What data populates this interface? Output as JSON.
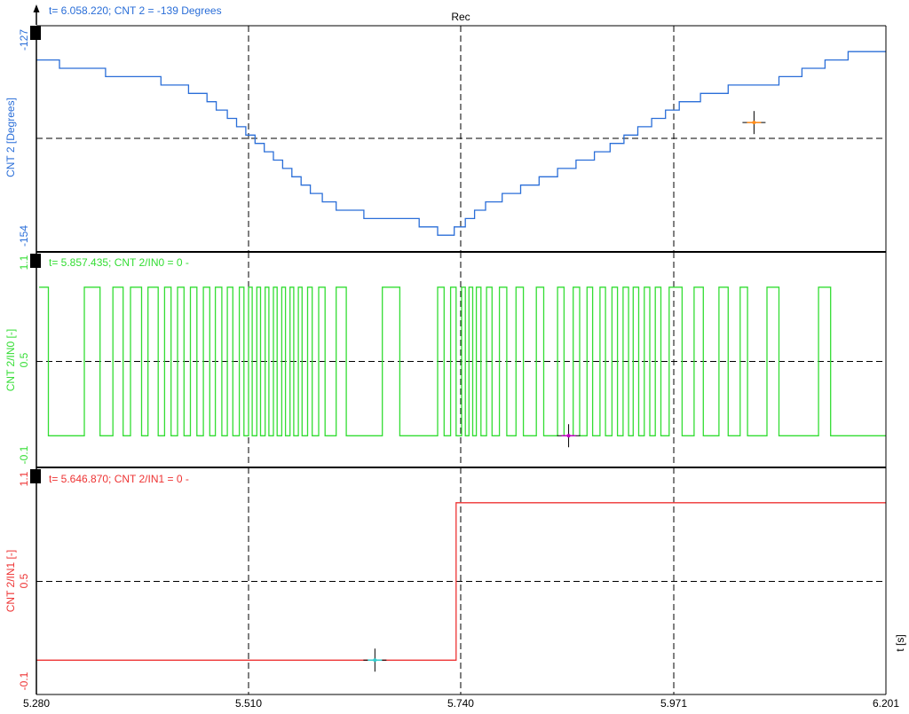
{
  "chart_data": {
    "type": "line",
    "title": "Rec",
    "xlabel": "t [s]",
    "xlim": [
      5.28,
      6.201
    ],
    "x_ticks": [
      "5.280",
      "5.510",
      "5.740",
      "5.971",
      "6.201"
    ],
    "grid": true,
    "panels": [
      {
        "name": "cnt2",
        "ylabel": "CNT 2 [Degrees]",
        "ylim": [
          -154,
          -127
        ],
        "y_ticks": [
          "-127",
          "-154"
        ],
        "color": "#2a6ed8",
        "cursor_label": "t= 6.058.220; CNT 2 = -139 Degrees",
        "cursor": {
          "x": 6.058,
          "y": -138.5
        },
        "series": [
          {
            "x": [
              5.28,
              5.305,
              5.305,
              5.355,
              5.355,
              5.415,
              5.415,
              5.445,
              5.445,
              5.465,
              5.465,
              5.475,
              5.475,
              5.487,
              5.487,
              5.497,
              5.497,
              5.507,
              5.507,
              5.517,
              5.517,
              5.527,
              5.527,
              5.537,
              5.537,
              5.547,
              5.547,
              5.557,
              5.557,
              5.567,
              5.567,
              5.577,
              5.577,
              5.59,
              5.59,
              5.605,
              5.605,
              5.635,
              5.635,
              5.695,
              5.695,
              5.715,
              5.715,
              5.733,
              5.733,
              5.745,
              5.745,
              5.755,
              5.755,
              5.767,
              5.767,
              5.785,
              5.785,
              5.805,
              5.805,
              5.825,
              5.825,
              5.845,
              5.845,
              5.865,
              5.865,
              5.885,
              5.885,
              5.902,
              5.902,
              5.917,
              5.917,
              5.932,
              5.932,
              5.947,
              5.947,
              5.962,
              5.962,
              5.977,
              5.977,
              6.0,
              6.0,
              6.03,
              6.03,
              6.085,
              6.085,
              6.11,
              6.11,
              6.135,
              6.135,
              6.16,
              6.16,
              6.201
            ],
            "y": [
              -131,
              -131,
              -132,
              -132,
              -133,
              -133,
              -134,
              -134,
              -135,
              -135,
              -136,
              -136,
              -137,
              -137,
              -138,
              -138,
              -139,
              -139,
              -140,
              -140,
              -141,
              -141,
              -142,
              -142,
              -143,
              -143,
              -144,
              -144,
              -145,
              -145,
              -146,
              -146,
              -147,
              -147,
              -148,
              -148,
              -149,
              -149,
              -150,
              -150,
              -151,
              -151,
              -152,
              -152,
              -151,
              -151,
              -150,
              -150,
              -149,
              -149,
              -148,
              -148,
              -147,
              -147,
              -146,
              -146,
              -145,
              -145,
              -144,
              -144,
              -143,
              -143,
              -142,
              -142,
              -141,
              -141,
              -140,
              -140,
              -139,
              -139,
              -138,
              -138,
              -137,
              -137,
              -136,
              -136,
              -135,
              -135,
              -134,
              -134,
              -133,
              -133,
              -132,
              -132,
              -131,
              -131,
              -130,
              -130
            ]
          }
        ]
      },
      {
        "name": "cnt2-in0",
        "ylabel": "CNT 2/IN0 [-]",
        "ylim": [
          -0.1,
          1.1
        ],
        "y_ticks": [
          "1.1",
          "0.5",
          "-0.1"
        ],
        "color": "#33dd33",
        "cursor_label": "t= 5.857.435; CNT 2/IN0 = 0 -",
        "cursor": {
          "x": 5.857,
          "y": 0
        },
        "series": [
          {
            "x": [
              5.283,
              5.293,
              5.332,
              5.349,
              5.363,
              5.374,
              5.382,
              5.394,
              5.401,
              5.412,
              5.419,
              5.426,
              5.433,
              5.44,
              5.447,
              5.454,
              5.461,
              5.468,
              5.474,
              5.481,
              5.487,
              5.493,
              5.5,
              5.505,
              5.51,
              5.514,
              5.519,
              5.523,
              5.528,
              5.532,
              5.537,
              5.541,
              5.546,
              5.55,
              5.555,
              5.559,
              5.564,
              5.568,
              5.574,
              5.579,
              5.586,
              5.593,
              5.605,
              5.616,
              5.655,
              5.674,
              5.715,
              5.722,
              5.729,
              5.735,
              5.741,
              5.745,
              5.749,
              5.753,
              5.757,
              5.762,
              5.768,
              5.774,
              5.782,
              5.79,
              5.8,
              5.808,
              5.822,
              5.83,
              5.845,
              5.852,
              5.862,
              5.869,
              5.877,
              5.883,
              5.891,
              5.897,
              5.904,
              5.91,
              5.916,
              5.922,
              5.927,
              5.933,
              5.939,
              5.945,
              5.951,
              5.957,
              5.966,
              5.98,
              5.993,
              6.003,
              6.02,
              6.03,
              6.043,
              6.051,
              6.072,
              6.085,
              6.128,
              6.141
            ],
            "y": [
              1,
              0,
              1,
              0,
              1,
              0,
              1,
              0,
              1,
              0,
              1,
              0,
              1,
              0,
              1,
              0,
              1,
              0,
              1,
              0,
              1,
              0,
              1,
              0,
              1,
              0,
              1,
              0,
              1,
              0,
              1,
              0,
              1,
              0,
              1,
              0,
              1,
              0,
              1,
              0,
              1,
              0,
              1,
              0,
              1,
              0,
              1,
              0,
              1,
              0,
              1,
              0,
              1,
              0,
              1,
              0,
              1,
              0,
              1,
              0,
              1,
              0,
              1,
              0,
              1,
              0,
              1,
              0,
              1,
              0,
              1,
              0,
              1,
              0,
              1,
              0,
              1,
              0,
              1,
              0,
              1,
              0,
              1,
              0,
              1,
              0,
              1,
              0,
              1,
              0,
              1,
              0,
              1,
              0
            ]
          }
        ]
      },
      {
        "name": "cnt2-in1",
        "ylabel": "CNT 2/IN1 [-]",
        "ylim": [
          -0.1,
          1.1
        ],
        "y_ticks": [
          "1.1",
          "0.5",
          "-0.1"
        ],
        "color": "#ee3333",
        "cursor_label": "t= 5.646.870; CNT 2/IN1 = 0 -",
        "cursor": {
          "x": 5.647,
          "y": 0
        },
        "series": [
          {
            "x": [
              5.28,
              5.735,
              5.735,
              6.201
            ],
            "y": [
              0,
              0,
              1,
              1
            ]
          }
        ]
      }
    ]
  }
}
